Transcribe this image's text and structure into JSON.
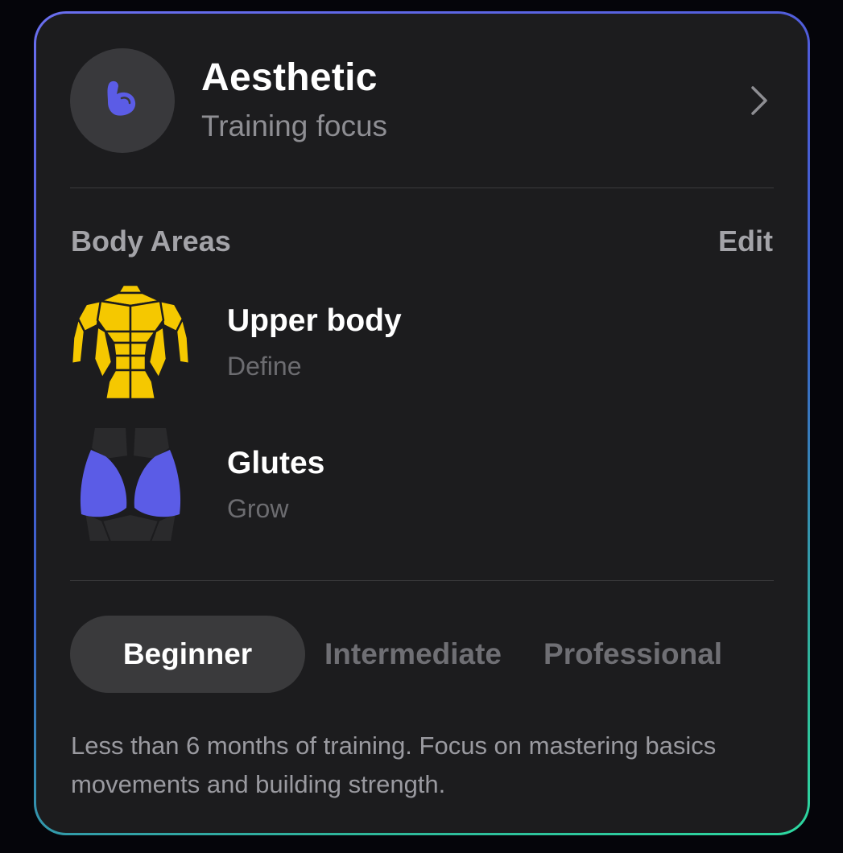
{
  "focus": {
    "title": "Aesthetic",
    "subtitle": "Training focus",
    "icon": "flexed-bicep-icon",
    "accent": "#5b5ce6"
  },
  "body_areas": {
    "title": "Body Areas",
    "edit_label": "Edit",
    "items": [
      {
        "name": "Upper body",
        "goal": "Define",
        "icon": "upper-body-muscles-icon",
        "color": "#f5c800"
      },
      {
        "name": "Glutes",
        "goal": "Grow",
        "icon": "glutes-muscles-icon",
        "color": "#5b5ce6"
      }
    ]
  },
  "levels": {
    "options": [
      "Beginner",
      "Intermediate",
      "Professional"
    ],
    "selected": "Beginner"
  },
  "description": "Less than 6 months of training. Focus on mastering basics movements and building strength.",
  "colors": {
    "card_bg": "#1c1c1e",
    "border_gradient_start": "#6a6ff0",
    "border_gradient_end": "#2dd8a0"
  }
}
